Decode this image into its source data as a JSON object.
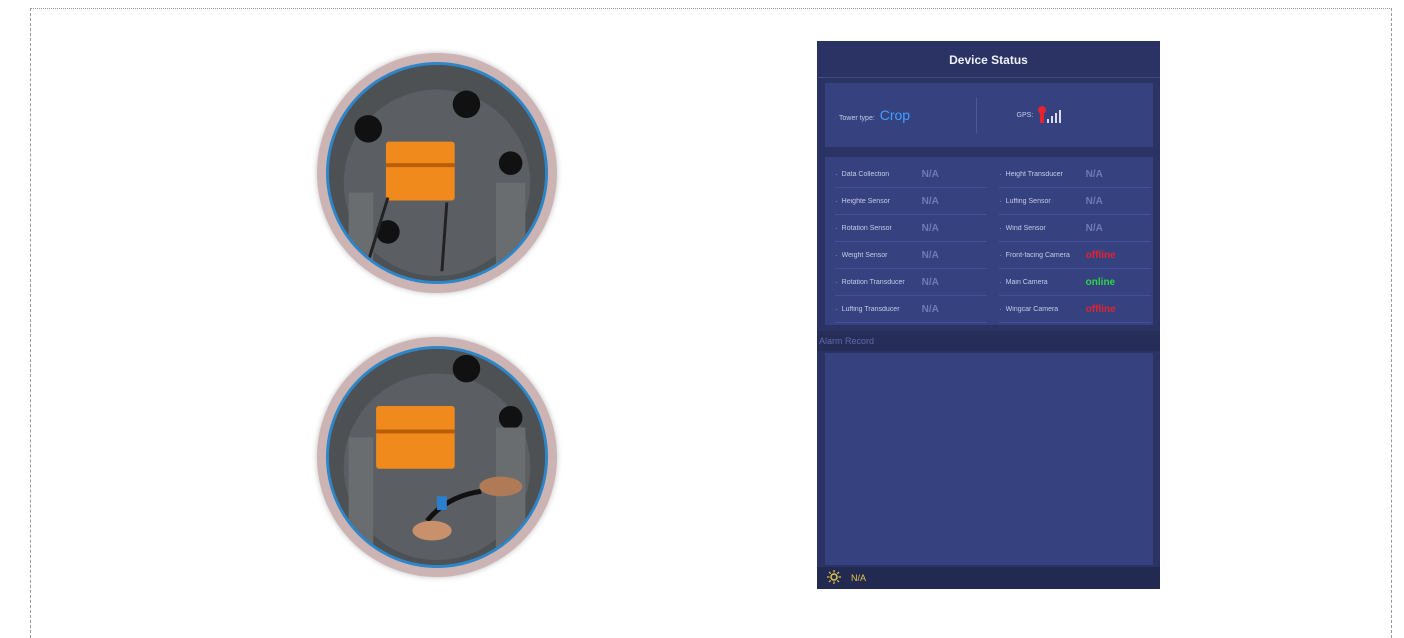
{
  "photos": [
    {
      "name": "sensor-box-photo",
      "description_icon": "photo-icon"
    },
    {
      "name": "connecting-cable-photo",
      "description_icon": "photo-icon"
    }
  ],
  "device_status": {
    "title": "Device Status",
    "tower_type_label": "Tower type:",
    "tower_type_value": "Crop",
    "gps_label": "GPS:",
    "sensors_left": [
      {
        "label": "Data Collection",
        "value": "N/A",
        "state": "na"
      },
      {
        "label": "Heighte Sensor",
        "value": "N/A",
        "state": "na"
      },
      {
        "label": "Rotation Sensor",
        "value": "N/A",
        "state": "na"
      },
      {
        "label": "Weight Sensor",
        "value": "N/A",
        "state": "na"
      },
      {
        "label": "Rotation Transducer",
        "value": "N/A",
        "state": "na"
      },
      {
        "label": "Luffing Transducer",
        "value": "N/A",
        "state": "na"
      }
    ],
    "sensors_right": [
      {
        "label": "Height Transducer",
        "value": "N/A",
        "state": "na"
      },
      {
        "label": "Luffing Sensor",
        "value": "N/A",
        "state": "na"
      },
      {
        "label": "Wind Sensor",
        "value": "N/A",
        "state": "na"
      },
      {
        "label": "Front-facing Camera",
        "value": "offline",
        "state": "offline"
      },
      {
        "label": "Main Camera",
        "value": "online",
        "state": "online"
      },
      {
        "label": "Wingcar Camera",
        "value": "offline",
        "state": "offline"
      }
    ],
    "alarm_title": "Alarm Record",
    "footer_value": "N/A",
    "colors": {
      "panel": "#2a3363",
      "card": "#364180",
      "accent_blue": "#3fa0ff",
      "offline": "#e3232e",
      "online": "#2fd34a",
      "footer_text": "#e7c544"
    }
  }
}
